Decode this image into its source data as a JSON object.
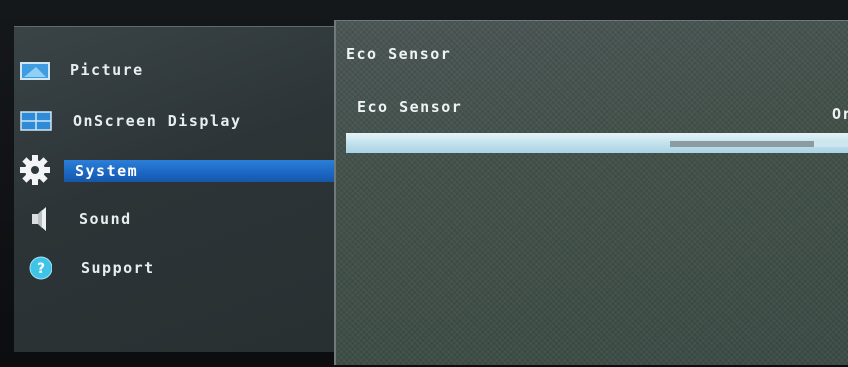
{
  "menu": {
    "items": [
      {
        "label": "Picture",
        "icon": "picture-icon"
      },
      {
        "label": "OnScreen Display",
        "icon": "osd-icon"
      },
      {
        "label": "System",
        "icon": "gear-icon",
        "selected": true
      },
      {
        "label": "Sound",
        "icon": "speaker-icon"
      },
      {
        "label": "Support",
        "icon": "help-icon"
      }
    ]
  },
  "panel": {
    "title": "Eco Sensor",
    "rows": [
      {
        "label": "Eco Sensor",
        "value": "Or"
      },
      {
        "label": "",
        "slider_fraction": 0.8
      }
    ]
  },
  "colors": {
    "selection": "#1b66c2",
    "row_highlight": "#bfe0ec",
    "left_panel": "#2f383b",
    "right_panel": "#445149"
  }
}
